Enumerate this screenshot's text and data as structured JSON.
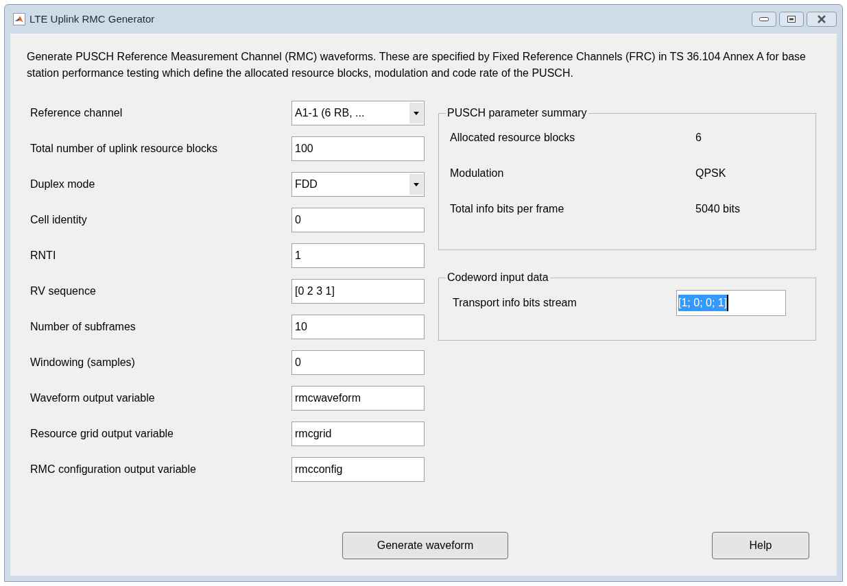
{
  "window": {
    "title": "LTE Uplink RMC Generator"
  },
  "description": "Generate PUSCH Reference Measurement Channel (RMC) waveforms. These are specified by Fixed Reference Channels (FRC) in TS 36.104 Annex A for base station performance testing which define the allocated resource blocks, modulation and code rate of the PUSCH.",
  "parameters": [
    {
      "label": "Reference channel",
      "kind": "dropdown",
      "value": "A1-1  (6 RB,  ..."
    },
    {
      "label": "Total number of uplink resource blocks",
      "kind": "text",
      "value": "100"
    },
    {
      "label": "Duplex mode",
      "kind": "dropdown",
      "value": "FDD"
    },
    {
      "label": "Cell identity",
      "kind": "text",
      "value": "0"
    },
    {
      "label": "RNTI",
      "kind": "text",
      "value": "1"
    },
    {
      "label": "RV sequence",
      "kind": "text",
      "value": "[0 2 3 1]"
    },
    {
      "label": "Number of subframes",
      "kind": "text",
      "value": "10"
    },
    {
      "label": "Windowing (samples)",
      "kind": "text",
      "value": "0"
    },
    {
      "label": "Waveform output variable",
      "kind": "text",
      "value": "rmcwaveform"
    },
    {
      "label": "Resource grid output variable",
      "kind": "text",
      "value": "rmcgrid"
    },
    {
      "label": "RMC configuration output variable",
      "kind": "text",
      "value": "rmcconfig"
    }
  ],
  "summary": {
    "title": "PUSCH parameter summary",
    "rows": [
      {
        "label": "Allocated resource blocks",
        "value": "6"
      },
      {
        "label": "Modulation",
        "value": "QPSK"
      },
      {
        "label": "Total info bits per frame",
        "value": "5040 bits"
      }
    ]
  },
  "codeword": {
    "title": "Codeword input data",
    "label": "Transport info bits stream",
    "value": "[1; 0; 0; 1]",
    "text_selected": true
  },
  "buttons": [
    "Generate waveform",
    "Help"
  ]
}
